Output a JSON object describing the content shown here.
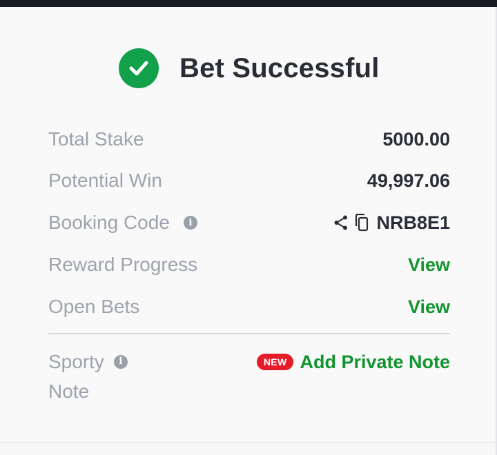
{
  "header": {
    "title": "Bet Successful",
    "status_icon": "check-circle-icon",
    "accent_color": "#12a04a"
  },
  "rows": [
    {
      "label": "Total Stake",
      "value": "5000.00"
    },
    {
      "label": "Potential Win",
      "value": "49,997.06"
    },
    {
      "label": "Booking Code",
      "value": "NRB8E1",
      "icons": [
        "info-icon",
        "share-icon",
        "copy-icon"
      ]
    },
    {
      "label": "Reward Progress",
      "value": "View"
    },
    {
      "label": "Open Bets",
      "value": "View"
    }
  ],
  "note": {
    "label_line1": "Sporty",
    "label_line2": "Note",
    "badge": "NEW",
    "action": "Add Private Note",
    "icon": "info-icon"
  },
  "colors": {
    "link": "#12952f",
    "badge": "#e61c2a",
    "label": "#9ea3ad",
    "value": "#2a2d35"
  }
}
